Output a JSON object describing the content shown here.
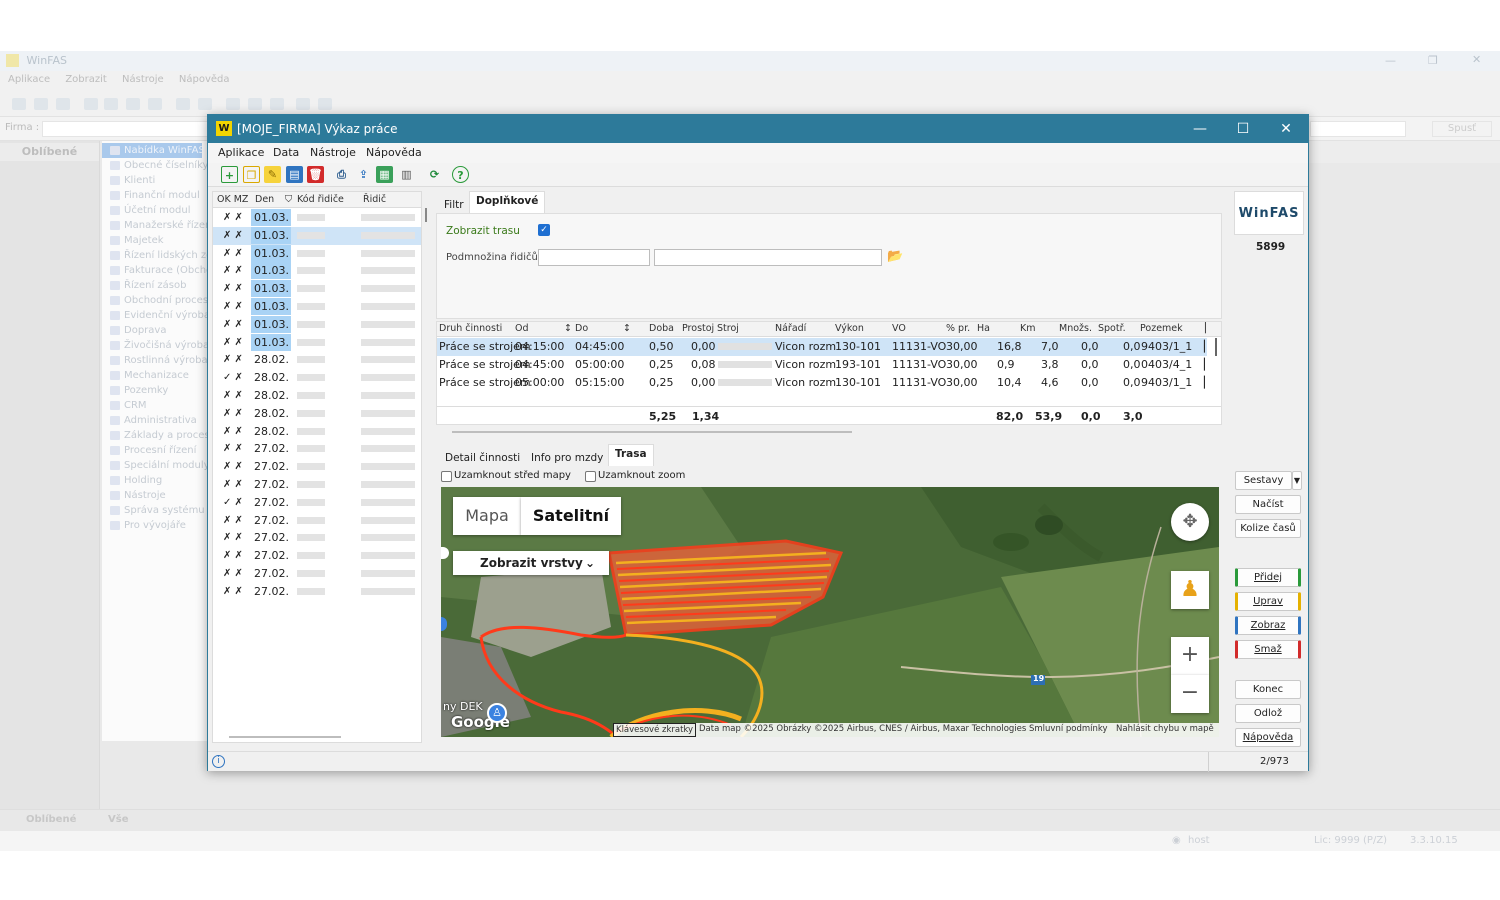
{
  "background_app": {
    "title": "WinFAS",
    "menu": [
      "Aplikace",
      "Zobrazit",
      "Nástroje",
      "Nápověda"
    ],
    "firma_label": "Firma :",
    "spust_label": "Spusť",
    "favorites_label": "Oblíbené",
    "tree": [
      "Nabídka WinFAS",
      "Obecné číselníky",
      "Klienti",
      "Finanční modul",
      "Účetní modul",
      "Manažerské řízení",
      "Majetek",
      "Řízení lidských zdrojů",
      "Fakturace (Obchod)",
      "Řízení zásob",
      "Obchodní proces",
      "Evidenční výroba",
      "Doprava",
      "Živočišná výroba",
      "Rostlinná výroba",
      "Mechanizace",
      "Pozemky",
      "CRM",
      "Administrativa",
      "Základy a procesy",
      "Procesní řízení",
      "Speciální moduly",
      "Holding",
      "Nástroje",
      "Správa systému",
      "Pro vývojáře"
    ],
    "bottom_tabs": [
      "Oblíbené",
      "Vše"
    ],
    "status": {
      "host": "host",
      "lic": "Lic: 9999 (P/Z)",
      "version": "3.3.10.15"
    }
  },
  "dialog": {
    "title": "[MOJE_FIRMA] Výkaz práce",
    "menu": [
      "Aplikace",
      "Data",
      "Nástroje",
      "Nápověda"
    ],
    "list": {
      "headers": [
        "OK MZ",
        "Den",
        "Kód řidiče",
        "Řidič"
      ],
      "rows": [
        {
          "ok": "✗ ✗",
          "den": "01.03."
        },
        {
          "ok": "✗ ✗",
          "den": "01.03."
        },
        {
          "ok": "✗ ✗",
          "den": "01.03."
        },
        {
          "ok": "✗ ✗",
          "den": "01.03."
        },
        {
          "ok": "✗ ✗",
          "den": "01.03."
        },
        {
          "ok": "✗ ✗",
          "den": "01.03."
        },
        {
          "ok": "✗ ✗",
          "den": "01.03."
        },
        {
          "ok": "✗ ✗",
          "den": "01.03."
        },
        {
          "ok": "✗ ✗",
          "den": "28.02."
        },
        {
          "ok": "✓ ✗",
          "den": "28.02."
        },
        {
          "ok": "✗ ✗",
          "den": "28.02."
        },
        {
          "ok": "✗ ✗",
          "den": "28.02."
        },
        {
          "ok": "✗ ✗",
          "den": "28.02."
        },
        {
          "ok": "✗ ✗",
          "den": "27.02."
        },
        {
          "ok": "✗ ✗",
          "den": "27.02."
        },
        {
          "ok": "✗ ✗",
          "den": "27.02."
        },
        {
          "ok": "✓ ✗",
          "den": "27.02."
        },
        {
          "ok": "✗ ✗",
          "den": "27.02."
        },
        {
          "ok": "✗ ✗",
          "den": "27.02."
        },
        {
          "ok": "✗ ✗",
          "den": "27.02."
        },
        {
          "ok": "✗ ✗",
          "den": "27.02."
        },
        {
          "ok": "✗ ✗",
          "den": "27.02."
        }
      ]
    },
    "top_tabs": [
      "Filtr",
      "Doplňkové"
    ],
    "zobrazit_trasu_label": "Zobrazit trasu",
    "podmnozina_label": "Podmnožina řidičů :",
    "grid": {
      "headers": [
        "Druh činnosti",
        "Od",
        "Do",
        "Doba",
        "Prostoj",
        "Stroj",
        "Nářadí",
        "Výkon",
        "VO",
        "% pr.",
        "Ha",
        "Km",
        "Množs.",
        "Spotř.",
        "Pozemek"
      ],
      "rows": [
        {
          "druh": "Práce se strojem",
          "od": "04:15:00",
          "do": "04:45:00",
          "doba": "0,50",
          "prostoj": "0,00",
          "naradi": "Vicon rozm",
          "vykon": "130-101",
          "vo": "11131-VO",
          "pr": "30,00",
          "ha": "16,8",
          "km": "7,0",
          "mnozs": "0,0",
          "spotr": "0,0",
          "pozemek": "9403/1_1"
        },
        {
          "druh": "Práce se strojem",
          "od": "04:45:00",
          "do": "05:00:00",
          "doba": "0,25",
          "prostoj": "0,08",
          "naradi": "Vicon rozm",
          "vykon": "193-101",
          "vo": "11131-VO",
          "pr": "30,00",
          "ha": "0,9",
          "km": "3,8",
          "mnozs": "0,0",
          "spotr": "0,0",
          "pozemek": "0403/4_1"
        },
        {
          "druh": "Práce se strojem",
          "od": "05:00:00",
          "do": "05:15:00",
          "doba": "0,25",
          "prostoj": "0,00",
          "naradi": "Vicon rozm",
          "vykon": "130-101",
          "vo": "11131-VO",
          "pr": "30,00",
          "ha": "10,4",
          "km": "4,6",
          "mnozs": "0,0",
          "spotr": "0,0",
          "pozemek": "9403/1_1"
        }
      ],
      "totals": {
        "doba": "5,25",
        "prostoj": "1,34",
        "ha": "82,0",
        "km": "53,9",
        "mnozs": "0,0",
        "spotr": "3,0"
      }
    },
    "bottom_tabs": [
      "Detail činnosti",
      "Info pro mzdy",
      "Trasa"
    ],
    "lock_center_label": "Uzamknout střed mapy",
    "lock_zoom_label": "Uzamknout zoom",
    "map": {
      "type_map": "Mapa",
      "type_satellite": "Satelitní",
      "layers_label": "Zobrazit vrstvy",
      "road_badge": "19",
      "place_label": "ny DEK",
      "google_logo": "Google",
      "attribution": [
        "Klávesové zkratky",
        "Data map ©2025 Obrázky ©2025 Airbus, CNES / Airbus, Maxar Technologies",
        "Smluvní podmínky",
        "Nahlásit chybu v mapě"
      ],
      "zoom_in": "+",
      "zoom_out": "−"
    },
    "side": {
      "logo": "WinFAS",
      "number": "5899",
      "sestavy": "Sestavy",
      "nacist": "Načíst",
      "kolize": "Kolize časů",
      "pridej": "Přidej",
      "uprav": "Uprav",
      "zobraz": "Zobraz",
      "smaz": "Smaž",
      "konec": "Konec",
      "odloz": "Odlož",
      "napoveda": "Nápověda"
    },
    "status_counter": "2/973",
    "colors": {
      "titlebar": "#2d7a9a",
      "selection": "#cfe4f7",
      "date_highlight": "#a9d3f5"
    }
  }
}
